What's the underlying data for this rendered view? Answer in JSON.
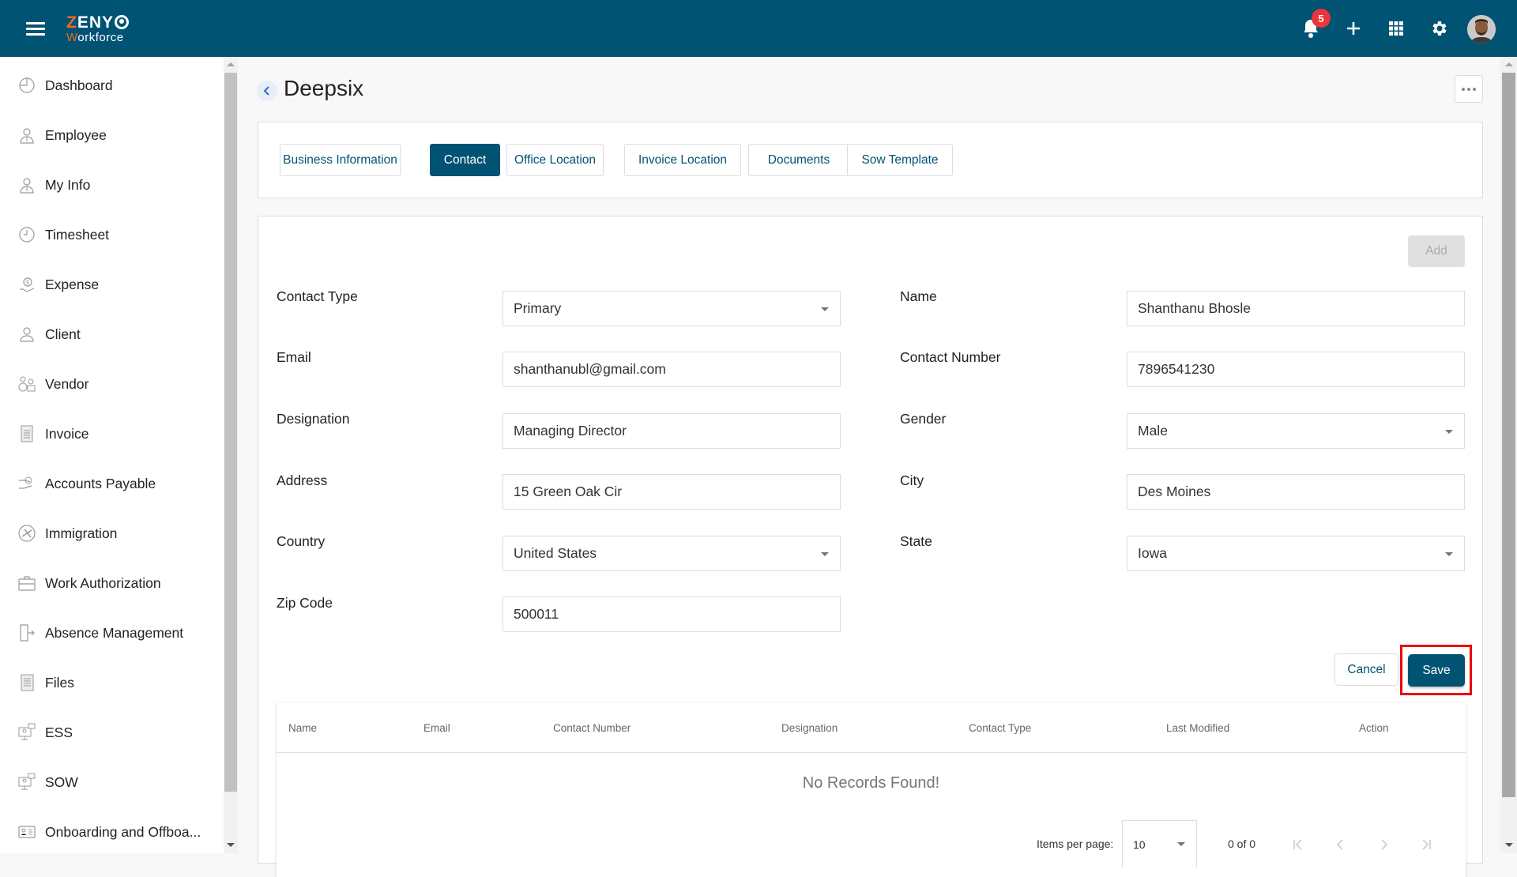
{
  "app": {
    "logo_line1": "ZENY",
    "logo_line2": "Workforce",
    "brand_color": "#005373",
    "accent_color": "#f26b21"
  },
  "header": {
    "notifications_count": "5",
    "icons": [
      "menu-icon",
      "bell-icon",
      "plus-icon",
      "apps-grid-icon",
      "gear-icon",
      "avatar"
    ]
  },
  "sidebar": {
    "items": [
      {
        "label": "Dashboard",
        "icon": "dashboard-icon"
      },
      {
        "label": "Employee",
        "icon": "employee-icon"
      },
      {
        "label": "My Info",
        "icon": "my-info-icon"
      },
      {
        "label": "Timesheet",
        "icon": "clock-icon"
      },
      {
        "label": "Expense",
        "icon": "expense-icon"
      },
      {
        "label": "Client",
        "icon": "client-icon"
      },
      {
        "label": "Vendor",
        "icon": "vendor-icon"
      },
      {
        "label": "Invoice",
        "icon": "invoice-icon"
      },
      {
        "label": "Accounts Payable",
        "icon": "accounts-payable-icon"
      },
      {
        "label": "Immigration",
        "icon": "immigration-icon"
      },
      {
        "label": "Work Authorization",
        "icon": "briefcase-icon"
      },
      {
        "label": "Absence Management",
        "icon": "door-exit-icon"
      },
      {
        "label": "Files",
        "icon": "files-icon"
      },
      {
        "label": "ESS",
        "icon": "ess-icon"
      },
      {
        "label": "SOW",
        "icon": "sow-icon"
      },
      {
        "label": "Onboarding and Offboa...",
        "icon": "id-card-icon"
      }
    ]
  },
  "page": {
    "title": "Deepsix",
    "tabs": [
      {
        "label": "Business Information",
        "active": false
      },
      {
        "label": "Contact",
        "active": true
      },
      {
        "label": "Office Location",
        "active": false
      },
      {
        "label": "Invoice Location",
        "active": false
      },
      {
        "label": "Documents",
        "active": false
      },
      {
        "label": "Sow Template",
        "active": false
      }
    ]
  },
  "form": {
    "add_label": "Add",
    "fields": {
      "contact_type": {
        "label": "Contact Type",
        "value": "Primary"
      },
      "name": {
        "label": "Name",
        "value": "Shanthanu Bhosle"
      },
      "email": {
        "label": "Email",
        "value": "shanthanubl@gmail.com"
      },
      "contact_number": {
        "label": "Contact Number",
        "value": "7896541230"
      },
      "designation": {
        "label": "Designation",
        "value": "Managing Director"
      },
      "gender": {
        "label": "Gender",
        "value": "Male"
      },
      "address": {
        "label": "Address",
        "value": "15 Green Oak Cir"
      },
      "city": {
        "label": "City",
        "value": "Des Moines"
      },
      "country": {
        "label": "Country",
        "value": "United States"
      },
      "state": {
        "label": "State",
        "value": "Iowa"
      },
      "zip_code": {
        "label": "Zip Code",
        "value": "500011"
      }
    },
    "cancel_label": "Cancel",
    "save_label": "Save"
  },
  "table": {
    "columns": [
      "Name",
      "Email",
      "Contact Number",
      "Designation",
      "Contact Type",
      "Last Modified",
      "Action"
    ],
    "empty_message": "No Records Found!",
    "pagination": {
      "items_per_page_label": "Items per page:",
      "items_per_page": "10",
      "range": "0 of 0"
    }
  }
}
